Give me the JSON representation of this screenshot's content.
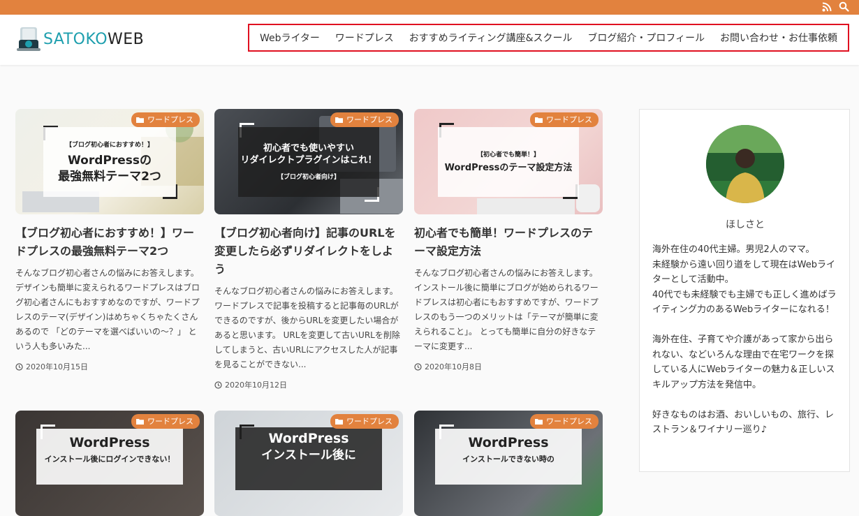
{
  "topbar": {
    "color": "#e2823e",
    "icons": [
      "rss-icon",
      "search-icon"
    ]
  },
  "logo": {
    "text_a": "SATOKO",
    "text_b": "WEB"
  },
  "nav": {
    "items": [
      {
        "label": "Webライター"
      },
      {
        "label": "ワードプレス"
      },
      {
        "label": "おすすめライティング講座&スクール"
      },
      {
        "label": "ブログ紹介・プロフィール"
      },
      {
        "label": "お問い合わせ・お仕事依頼"
      }
    ]
  },
  "posts": [
    {
      "category": "ワードプレス",
      "thumb_small": "【ブログ初心者におすすめ！】",
      "thumb_big_1": "WordPressの",
      "thumb_big_2": "最強無料テーマ2つ",
      "title": "【ブログ初心者におすすめ！】ワードプレスの最強無料テーマ2つ",
      "excerpt": "そんなブログ初心者さんの悩みにお答えします。 デザインも簡単に変えられるワードプレスはブログ初心者さんにもおすすめなのですが、ワードプレスのテーマ(デザイン)はめちゃくちゃたくさんあるので 「どのテーマを選べばいいの～？」 という人も多いみた...",
      "date": "2020年10月15日"
    },
    {
      "category": "ワードプレス",
      "thumb_big_1": "初心者でも使いやすい",
      "thumb_big_2": "リダイレクトプラグインはこれ！",
      "thumb_small": "【ブログ初心者向け】",
      "title": "【ブログ初心者向け】記事のURLを変更したら必ずリダイレクトをしよう",
      "excerpt": "そんなブログ初心者さんの悩みにお答えします。 ワードプレスで記事を投稿すると記事毎のURLができるのですが、後からURLを変更したい場合があると思います。 URLを変更して古いURLを削除してしまうと、古いURLにアクセスした人が記事を見ることができない...",
      "date": "2020年10月12日"
    },
    {
      "category": "ワードプレス",
      "thumb_small": "【初心者でも簡単！】",
      "thumb_big_1": "WordPressのテーマ設定方法",
      "thumb_big_2": "",
      "title": "初心者でも簡単！ワードプレスのテーマ設定方法",
      "excerpt": "そんなブログ初心者さんの悩みにお答えします。 インストール後に簡単にブログが始められるワードプレスは初心者にもおすすめですが、ワードプレスのもう一つのメリットは「テーマが簡単に変えられること」。 とっても簡単に自分の好きなテーマに変更す...",
      "date": "2020年10月8日"
    },
    {
      "category": "ワードプレス",
      "thumb_big_1": "WordPress",
      "thumb_small": "インストール後にログインできない！",
      "thumb_big_2": ""
    },
    {
      "category": "ワードプレス",
      "thumb_big_1": "WordPress",
      "thumb_big_2": "インストール後に",
      "thumb_small": ""
    },
    {
      "category": "ワードプレス",
      "thumb_big_1": "WordPress",
      "thumb_small": "インストールできない時の",
      "thumb_big_2": ""
    }
  ],
  "sidebar": {
    "author_name": "ほしさと",
    "bio": [
      "海外在住の40代主婦。男児2人のママ。",
      "未経験から遠い回り道をして現在はWebライターとして活動中。",
      "40代でも未経験でも主婦でも正しく進めばライティング力のあるWebライターになれる！",
      "",
      "海外在住、子育てや介護があって家から出られない、などいろんな理由で在宅ワークを探している人にWebライターの魅力＆正しいスキルアップ方法を発信中。",
      "",
      "好きなものはお酒、おいしいもの、旅行、レストラン＆ワイナリー巡り♪"
    ]
  },
  "colors": {
    "accent": "#e2823e",
    "teal": "#1e9fae",
    "highlight": "#e01020"
  }
}
